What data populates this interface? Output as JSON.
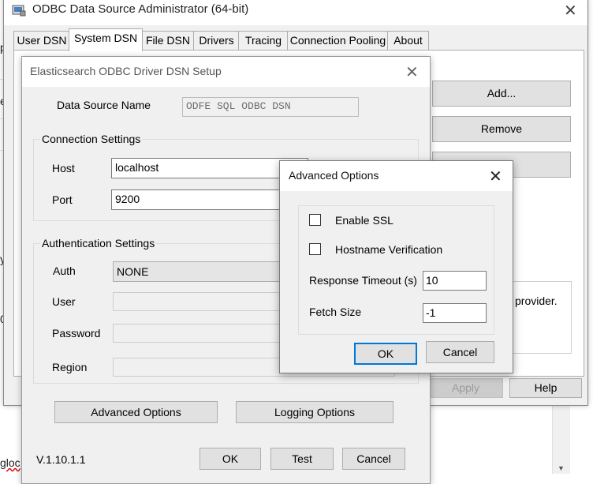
{
  "background": {
    "fragments": [
      "-",
      "p",
      "e",
      "y",
      "0",
      "gloc"
    ],
    "fragment_provider": "provider."
  },
  "main_window": {
    "title": "ODBC Data Source Administrator (64-bit)",
    "icon": "odbc-admin-icon",
    "close_icon": "close-icon",
    "tabs": [
      {
        "label": "User DSN"
      },
      {
        "label": "System DSN",
        "active": true
      },
      {
        "label": "File DSN"
      },
      {
        "label": "Drivers"
      },
      {
        "label": "Tracing"
      },
      {
        "label": "Connection Pooling"
      },
      {
        "label": "About"
      }
    ],
    "buttons": {
      "add": "Add...",
      "remove": "Remove",
      "configure": "...",
      "apply": "Apply",
      "help": "Help"
    },
    "info_text": "provider."
  },
  "setup_dialog": {
    "title": "Elasticsearch ODBC Driver DSN Setup",
    "data_source_name_label": "Data Source Name",
    "data_source_name_value": "ODFE SQL ODBC DSN",
    "connection_settings": {
      "group_label": "Connection Settings",
      "host_label": "Host",
      "host_value": "localhost",
      "port_label": "Port",
      "port_value": "9200"
    },
    "authentication_settings": {
      "group_label": "Authentication Settings",
      "auth_label": "Auth",
      "auth_value": "NONE",
      "user_label": "User",
      "user_value": "",
      "password_label": "Password",
      "password_value": "",
      "region_label": "Region",
      "region_value": ""
    },
    "advanced_options_button": "Advanced Options",
    "logging_options_button": "Logging Options",
    "version": "V.1.10.1.1",
    "ok_button": "OK",
    "test_button": "Test",
    "cancel_button": "Cancel"
  },
  "advanced_dialog": {
    "title": "Advanced Options",
    "enable_ssl_label": "Enable SSL",
    "enable_ssl_checked": false,
    "hostname_verification_label": "Hostname Verification",
    "hostname_verification_checked": false,
    "response_timeout_label": "Response Timeout (s)",
    "response_timeout_value": "10",
    "fetch_size_label": "Fetch Size",
    "fetch_size_value": "-1",
    "ok_button": "OK",
    "cancel_button": "Cancel"
  },
  "colors": {
    "window_bg": "#f0f0f0",
    "focus_border": "#0078d7",
    "button_bg": "#e1e1e1"
  }
}
